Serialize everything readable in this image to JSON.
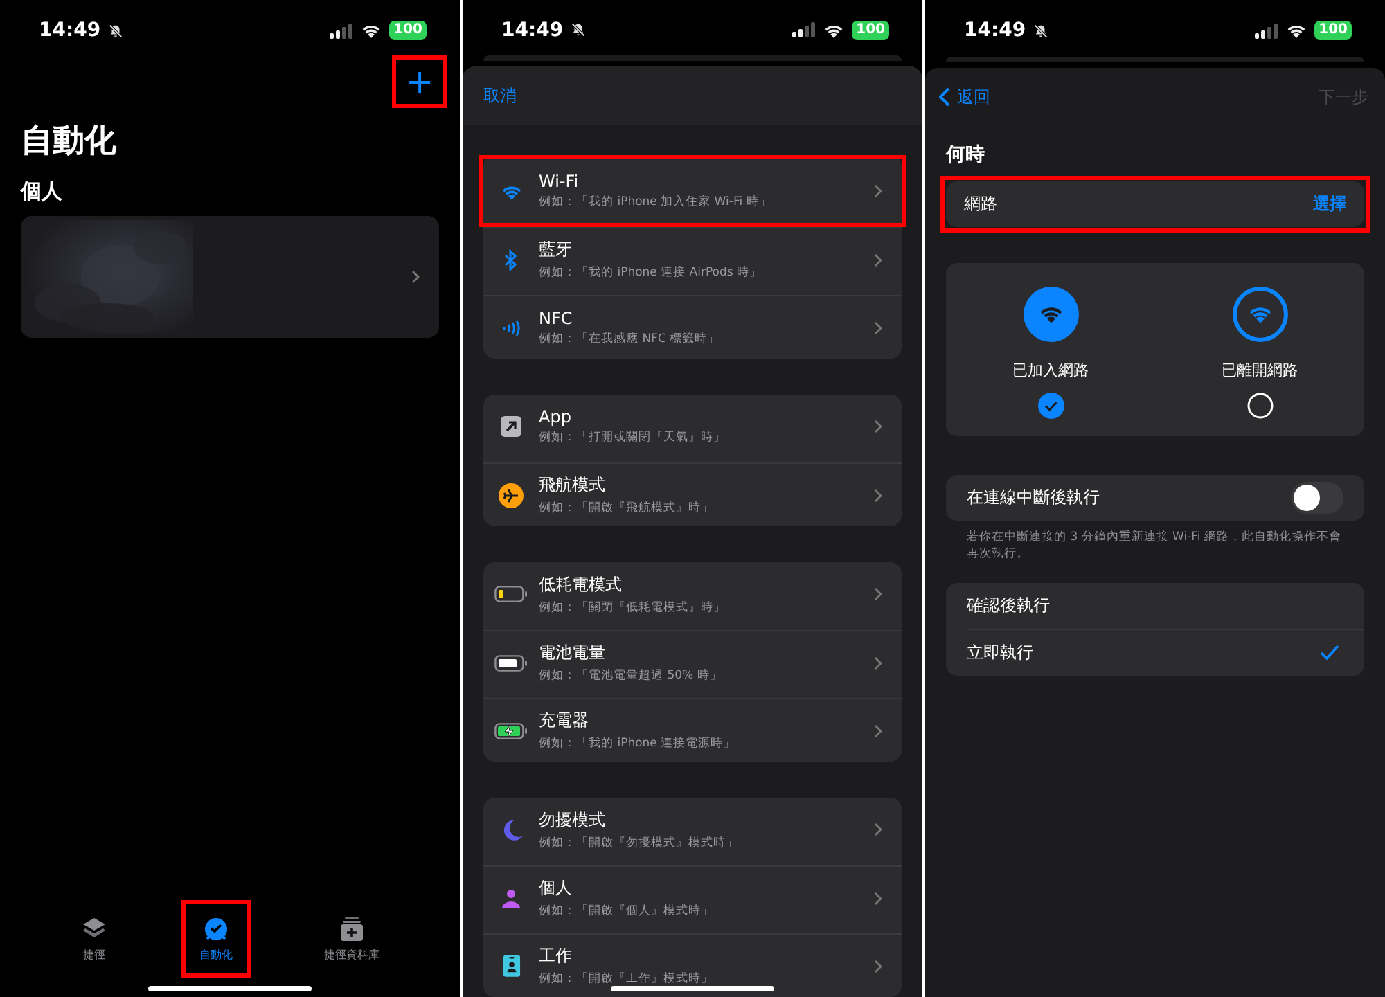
{
  "screens": [
    {
      "kind": "home",
      "status": {
        "time": "14:49",
        "battery": "100"
      },
      "add_button": {
        "label": "+",
        "highlighted": true
      },
      "title": "自動化",
      "section": "個人",
      "card": {
        "kind": "picture"
      },
      "tab_bar": [
        {
          "label": "捷徑",
          "kind": "shortcuts",
          "selected": false,
          "highlighted": false
        },
        {
          "label": "自動化",
          "kind": "automation",
          "selected": true,
          "highlighted": true
        },
        {
          "label": "捷徑資料庫",
          "kind": "gallery",
          "selected": false,
          "highlighted": false
        }
      ]
    },
    {
      "kind": "triggers",
      "status": {
        "time": "14:49",
        "battery": "100"
      },
      "cancel": "取消",
      "groups": [
        [
          {
            "kind": "wifi",
            "title": "Wi-Fi",
            "subtitle": "例如：「我的 iPhone 加入住家 Wi-Fi 時」",
            "highlighted": true
          },
          {
            "kind": "bluetooth",
            "title": "藍牙",
            "subtitle": "例如：「我的 iPhone 連接 AirPods 時」",
            "highlighted": false
          },
          {
            "kind": "nfc",
            "title": "NFC",
            "subtitle": "例如：「在我感應 NFC 標籤時」",
            "highlighted": false
          }
        ],
        [
          {
            "kind": "app",
            "title": "App",
            "subtitle": "例如：「打開或關閉『天氣』時」",
            "highlighted": false
          },
          {
            "kind": "airplane",
            "title": "飛航模式",
            "subtitle": "例如：「開啟『飛航模式』時」",
            "highlighted": false
          }
        ],
        [
          {
            "kind": "low_power",
            "title": "低耗電模式",
            "subtitle": "例如：「關閉『低耗電模式』時」",
            "highlighted": false
          },
          {
            "kind": "battery",
            "title": "電池電量",
            "subtitle": "例如：「電池電量超過 50% 時」",
            "highlighted": false
          },
          {
            "kind": "charger",
            "title": "充電器",
            "subtitle": "例如：「我的 iPhone 連接電源時」",
            "highlighted": false
          }
        ],
        [
          {
            "kind": "focus",
            "title": "勿擾模式",
            "subtitle": "例如：「開啟『勿擾模式』模式時」",
            "highlighted": false
          },
          {
            "kind": "personal",
            "title": "個人",
            "subtitle": "例如：「開啟『個人』模式時」",
            "highlighted": false
          },
          {
            "kind": "work",
            "title": "工作",
            "subtitle": "例如：「開啟『工作』模式時」",
            "highlighted": false
          }
        ]
      ]
    },
    {
      "kind": "wifi_trigger",
      "status": {
        "time": "14:49",
        "battery": "100"
      },
      "back": "返回",
      "next": {
        "label": "下一步",
        "disabled": true
      },
      "heading": "何時",
      "trigger": {
        "label": "網路",
        "action": "選擇",
        "highlighted": true
      },
      "options": [
        {
          "label": "已加入網路",
          "selected": true
        },
        {
          "label": "已離開網路",
          "selected": false
        }
      ],
      "toggle": {
        "label": "在連線中斷後執行",
        "on": false
      },
      "note": "若你在中斷連接的 3 分鐘內重新連接 Wi-Fi 網路，此自動化操作不會再次執行。",
      "run_options": [
        {
          "label": "確認後執行",
          "selected": false
        },
        {
          "label": "立即執行",
          "selected": true
        }
      ]
    }
  ]
}
